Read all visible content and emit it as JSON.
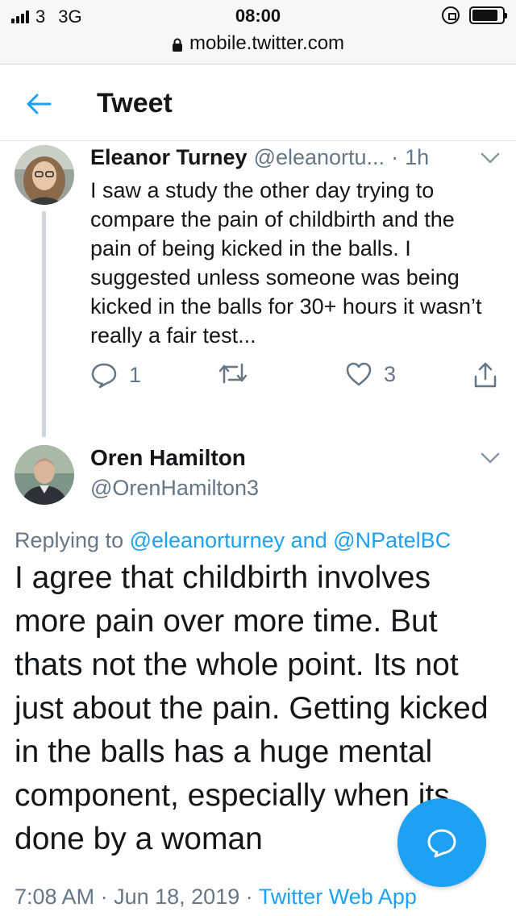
{
  "status_bar": {
    "carrier": "3",
    "network": "3G",
    "time": "08:00",
    "url": "mobile.twitter.com",
    "battery_level": 0.85
  },
  "header": {
    "title": "Tweet"
  },
  "parent_tweet": {
    "name": "Eleanor Turney",
    "handle": "@eleanortu...",
    "separator": "·",
    "time_ago": "1h",
    "text": "I saw a study the other day trying to compare the pain of childbirth and the pain of being kicked in the balls. I suggested unless someone was being kicked in the balls for 30+ hours it wasn’t really a fair test...",
    "reply_count": "1",
    "like_count": "3"
  },
  "main_tweet": {
    "name": "Oren Hamilton",
    "handle": "@OrenHamilton3",
    "replying_prefix": "Replying to",
    "mention_1": "@eleanorturney",
    "and_word": "and",
    "mention_2": "@NPatelBC",
    "text": "I agree that childbirth involves more pain over more time. But thats not the whole point. Its not just about the pain. Getting kicked in the balls has a huge mental component, especially when its done by a woman",
    "time": "7:08 AM",
    "separator": "·",
    "date": "Jun 18, 2019",
    "app": "Twitter Web App"
  },
  "icons": {
    "back": "arrow-left-icon",
    "reply": "speech-bubble-icon",
    "retweet": "retweet-icon",
    "like": "heart-icon",
    "share": "share-icon",
    "compose": "compose-reply-icon",
    "chevron": "chevron-down-icon"
  },
  "colors": {
    "accent": "#1da1f2",
    "secondary_text": "#657786",
    "primary_text": "#14171a"
  }
}
